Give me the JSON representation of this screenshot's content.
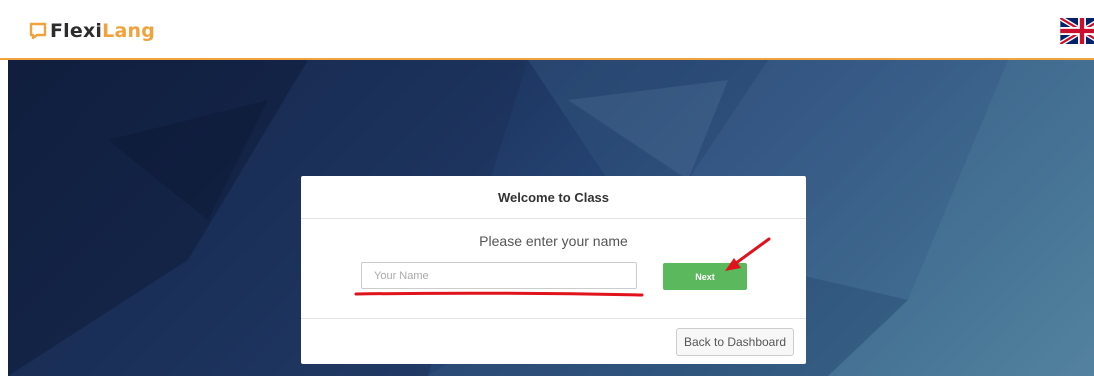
{
  "brand": {
    "name_part1": "Flexi",
    "name_part2": "Lang",
    "dark_color": "#2d2d2d",
    "accent_color": "#f0a23c",
    "logo_icon": "chat-bubble-icon"
  },
  "header": {
    "language_flag": "uk-flag-icon"
  },
  "dialog": {
    "title": "Welcome to Class",
    "prompt": "Please enter your name",
    "name_placeholder": "Your Name",
    "name_value": "",
    "next_label": "Next",
    "next_color": "#5cb85c",
    "back_label": "Back to Dashboard"
  },
  "annotations": {
    "color": "#e0121b",
    "items": [
      "underline-mark",
      "arrow-mark"
    ]
  }
}
